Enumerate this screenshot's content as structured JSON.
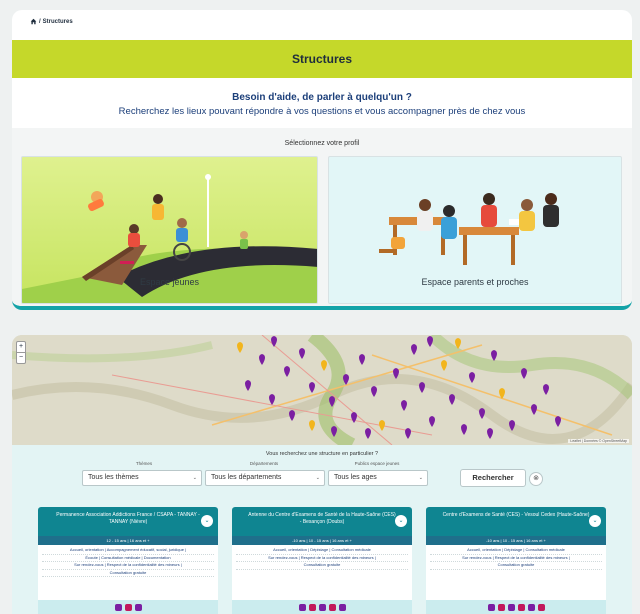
{
  "breadcrumb": {
    "separator": "/",
    "current": "Structures"
  },
  "banner": {
    "title": "Structures"
  },
  "help": {
    "title": "Besoin d'aide, de parler à quelqu'un ?",
    "subtitle": "Recherchez les lieux pouvant répondre à vos questions et vous accompagner près de chez vous"
  },
  "profiles": {
    "label": "Sélectionnez votre profil",
    "items": [
      {
        "label": "Espace jeunes"
      },
      {
        "label": "Espace parents et proches"
      }
    ]
  },
  "map": {
    "zoom_in": "+",
    "zoom_out": "−",
    "attribution": "Leaflet | Données © OpenStreetMap"
  },
  "search": {
    "title": "Vous recherchez une structure en particulier ?",
    "filters": [
      {
        "label": "Thèmes",
        "value": "Tous les thèmes"
      },
      {
        "label": "Départements",
        "value": "Tous les départements"
      },
      {
        "label": "Publics espace jeunes",
        "value": "Tous les ages"
      }
    ],
    "submit": "Rechercher",
    "reset": "⊗"
  },
  "structures": [
    {
      "name": "Permanence Association Addictions France / CSAPA - TANNAY - TANNAY (Nièvre)",
      "ages": "12 - 15 ans | 16 ans et +",
      "services": [
        "Accueil, orientation | Accompagnement éducatif, social, juridique |",
        "Écoute | Consultation médicale | Documentation",
        "Sur rendez-vous | Respect de la confidentialité des mineurs |",
        "Consultation gratuite"
      ]
    },
    {
      "name": "Antenne du Centre d'Examens de Santé de la Haute-Saône (CES) - Besançon (Doubs)",
      "ages": "-10 ans | 10 - 15 ans | 16 ans et +",
      "services": [
        "Accueil, orientation | Dépistage | Consultation médicale",
        "Sur rendez-vous | Respect de la confidentialité des mineurs |",
        "Consultation gratuite"
      ]
    },
    {
      "name": "Centre d'Examens de Santé (CES) - Vesoul Cedex (Haute-Saône)",
      "ages": "-10 ans | 10 - 15 ans | 16 ans et +",
      "services": [
        "Accueil, orientation | Dépistage | Consultation médicale",
        "Sur rendez-vous | Respect de la confidentialité des mineurs |",
        "Consultation gratuite"
      ]
    }
  ],
  "colors": {
    "accent": "#14a3a8",
    "banner": "#c5d82a",
    "card_header": "#0f8591",
    "marker_primary": "#7b1fa2",
    "marker_secondary": "#f2b51c"
  }
}
